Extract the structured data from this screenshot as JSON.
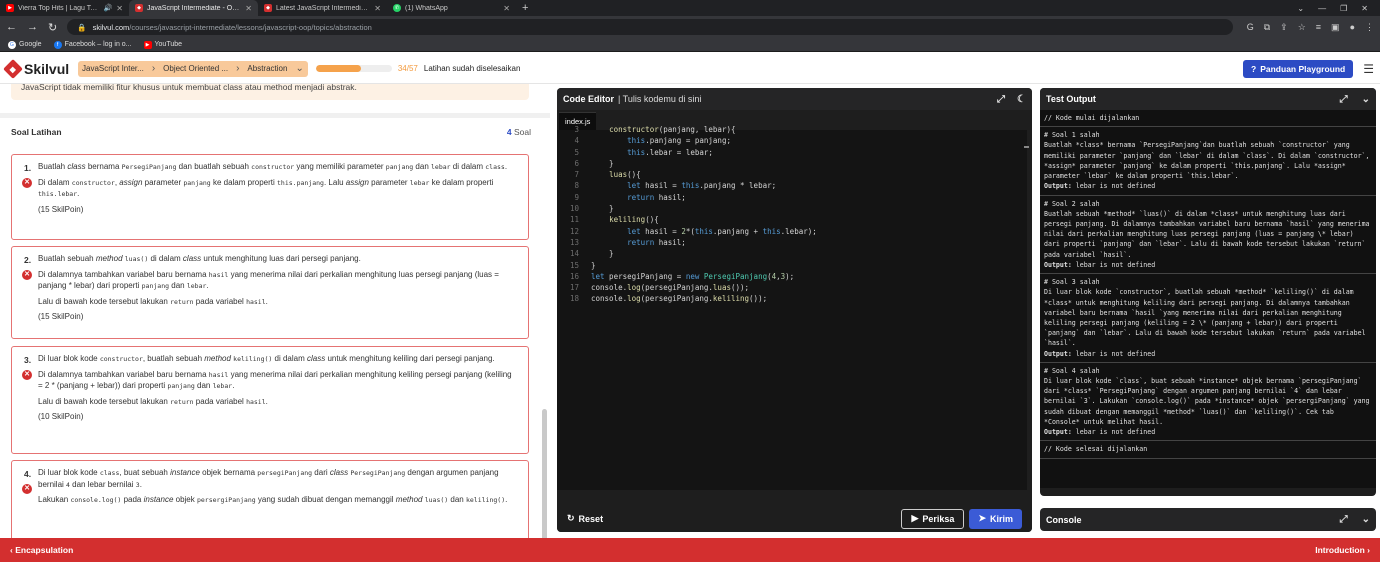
{
  "browser": {
    "tabs": [
      {
        "title": "Vierra Top Hits | Lagu Terbaik",
        "icon": "youtube-icon",
        "color": "#ff0000"
      },
      {
        "title": "JavaScript Intermediate - Object",
        "icon": "skilvul-icon",
        "color": "#d32f2f"
      },
      {
        "title": "Latest JavaScript Intermediate to",
        "icon": "skilvul-icon",
        "color": "#d32f2f"
      },
      {
        "title": "(1) WhatsApp",
        "icon": "whatsapp-icon",
        "color": "#25d366"
      }
    ],
    "url_domain": "skilvul.com",
    "url_path": "/courses/javascript-intermediate/lessons/javascript-oop/topics/abstraction",
    "bookmarks": [
      {
        "label": "Google",
        "icon": "google-icon"
      },
      {
        "label": "Facebook – log in o...",
        "icon": "facebook-icon"
      },
      {
        "label": "YouTube",
        "icon": "youtube-icon"
      }
    ]
  },
  "header": {
    "logo": "Skilvul",
    "breadcrumbs": [
      "JavaScript Inter...",
      "Object Oriented ...",
      "Abstraction"
    ],
    "progress_value": 0.5965,
    "progress_count": "34/57",
    "progress_label": "Latihan sudah diselesaikan",
    "guide_button": "Panduan Playground"
  },
  "left": {
    "note": "JavaScript tidak memiliki fitur khusus untuk membuat class atau method menjadi abstrak.",
    "title": "Soal Latihan",
    "count_num": "4",
    "count_label": "Soal",
    "questions": [
      {
        "num": "1.",
        "p1": "Buatlah class bernama PersegiPanjang dan buatlah sebuah constructor yang memiliki parameter panjang dan lebar di dalam class.",
        "p2": "Di dalam constructor, assign parameter panjang ke dalam properti this.panjang. Lalu assign parameter lebar ke dalam properti this.lebar.",
        "points": "(15 SkilPoin)"
      },
      {
        "num": "2.",
        "p1": "Buatlah sebuah method luas() di dalam class untuk menghitung luas dari persegi panjang.",
        "p2": "Di dalamnya tambahkan variabel baru bernama hasil yang menerima nilai dari perkalian menghitung luas persegi panjang (luas = panjang * lebar) dari properti panjang dan lebar.",
        "p3": "Lalu di bawah kode tersebut lakukan return pada variabel hasil.",
        "points": "(15 SkilPoin)"
      },
      {
        "num": "3.",
        "p1": "Di luar blok kode constructor, buatlah sebuah method keliling() di dalam class untuk menghitung keliling dari persegi panjang.",
        "p2": "Di dalamnya tambahkan variabel baru bernama hasil yang menerima nilai dari perkalian menghitung keliling persegi panjang (keliling = 2 * (panjang + lebar)) dari properti panjang dan lebar.",
        "p3": "Lalu di bawah kode tersebut lakukan return pada variabel hasil.",
        "points": "(10 SkilPoin)"
      },
      {
        "num": "4.",
        "p1": "Di luar blok kode class, buat sebuah instance objek bernama persegiPanjang dari class PersegiPanjang dengan argumen panjang bernilai 4 dan lebar bernilai 3.",
        "p2": "Lakukan console.log() pada instance objek persegiPanjang yang sudah dibuat dengan memanggil method luas() dan keliling()."
      }
    ]
  },
  "editor": {
    "title": "Code Editor",
    "subtitle": "| Tulis kodemu di sini",
    "file_tab": "index.js",
    "reset": "Reset",
    "check": "Periksa",
    "send": "Kirim",
    "lines": [
      {
        "n": "3",
        "html": "    <span class=\"fn\">constructor</span>(panjang, lebar){"
      },
      {
        "n": "4",
        "html": "        <span class=\"kw\">this</span>.panjang = panjang;"
      },
      {
        "n": "5",
        "html": "        <span class=\"kw\">this</span>.lebar = lebar;"
      },
      {
        "n": "6",
        "html": "    }"
      },
      {
        "n": "7",
        "html": "    <span class=\"fn\">luas</span>(){"
      },
      {
        "n": "8",
        "html": "        <span class=\"kw\">let</span> hasil = <span class=\"kw\">this</span>.panjang * lebar;"
      },
      {
        "n": "9",
        "html": "        <span class=\"kw\">return</span> hasil;"
      },
      {
        "n": "10",
        "html": "    }"
      },
      {
        "n": "11",
        "html": "    <span class=\"fn\">keliling</span>(){"
      },
      {
        "n": "12",
        "html": "        <span class=\"kw\">let</span> hasil = <span class=\"num2\">2</span>*(<span class=\"kw\">this</span>.panjang + <span class=\"kw\">this</span>.lebar);"
      },
      {
        "n": "13",
        "html": "        <span class=\"kw\">return</span> hasil;"
      },
      {
        "n": "14",
        "html": "    }"
      },
      {
        "n": "15",
        "html": "}"
      },
      {
        "n": "16",
        "html": "<span class=\"kw\">let</span> persegiPanjang = <span class=\"kw\">new</span> <span class=\"cls\">PersegiPanjang</span>(<span class=\"num2\">4</span>,<span class=\"num2\">3</span>);"
      },
      {
        "n": "17",
        "html": "console.<span class=\"fn\">log</span>(persegiPanjang.<span class=\"fn\">luas</span>());"
      },
      {
        "n": "18",
        "html": "console.<span class=\"fn\">log</span>(persegiPanjang.<span class=\"fn\">keliling</span>());"
      }
    ]
  },
  "test_output": {
    "title": "Test Output",
    "start": "// Kode mulai dijalankan",
    "blocks": [
      {
        "head": "# Soal 1 salah",
        "body": "Buatlah *class* bernama `PersegiPanjang`dan buatlah sebuah `constructor` yang memiliki parameter `panjang` dan `lebar` di dalam `class`. Di dalam `constructor`, *assign* parameter `panjang` ke dalam properti `this.panjang`. Lalu *assign* parameter `lebar` ke dalam properti `this.lebar`.",
        "output_label": "Output:",
        "output": "lebar is not defined"
      },
      {
        "head": "# Soal 2 salah",
        "body": "Buatlah sebuah *method* `luas()` di dalam *class* untuk menghitung luas dari persegi panjang. Di dalamnya tambahkan variabel baru bernama `hasil` yang menerima nilai dari perkalian menghitung luas persegi panjang (luas = panjang \\* lebar) dari properti `panjang` dan `lebar`. Lalu di bawah kode tersebut lakukan `return` pada variabel `hasil`.",
        "output_label": "Output:",
        "output": "lebar is not defined"
      },
      {
        "head": "# Soal 3 salah",
        "body": "Di luar blok kode `constructor`, buatlah sebuah *method* `keliling()` di dalam *class* untuk menghitung keliling dari persegi panjang. Di dalamnya tambahkan variabel baru bernama `hasil `yang menerima nilai dari perkalian menghitung keliling persegi panjang (keliling = 2 \\* (panjang + lebar)) dari properti `panjang` dan `lebar`. Lalu di bawah kode tersebut lakukan `return` pada variabel `hasil`.",
        "output_label": "Output:",
        "output": "lebar is not defined"
      },
      {
        "head": "# Soal 4 salah",
        "body": "Di luar blok kode `class`, buat sebuah *instance* objek bernama `persegiPanjang` dari *class* `PersegiPanjang` dengan argumen panjang bernilai `4` dan lebar bernilai `3`. Lakukan `console.log()` pada *instance* objek `persergiPanjang` yang sudah dibuat dengan memanggil *method* `luas()` dan `keliling()`. Cek tab *Console* untuk melihat hasil.",
        "output_label": "Output:",
        "output": "lebar is not defined"
      }
    ],
    "end": "// Kode selesai dijalankan"
  },
  "console": {
    "title": "Console"
  },
  "footer": {
    "prev": "Encapsulation",
    "next": "Introduction"
  }
}
